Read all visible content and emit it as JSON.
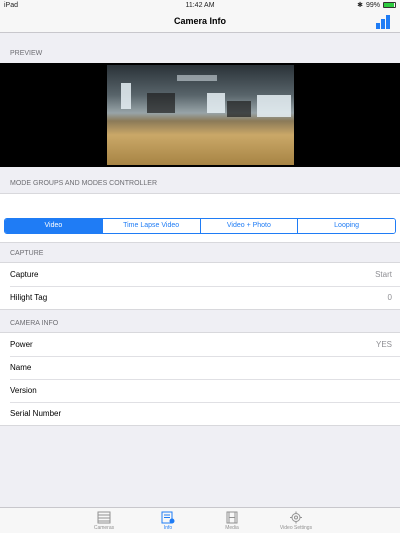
{
  "status_bar": {
    "device": "iPad",
    "time": "11:42 AM",
    "battery": "99%"
  },
  "nav": {
    "title": "Camera Info",
    "chart_button": "bar-chart-icon"
  },
  "preview": {
    "header": "PREVIEW"
  },
  "modes": {
    "header": "MODE GROUPS AND MODES CONTROLLER",
    "segments": [
      "Video",
      "Time Lapse Video",
      "Video + Photo",
      "Looping"
    ],
    "selected": "Video"
  },
  "capture": {
    "header": "CAPTURE",
    "rows": [
      {
        "label": "Capture",
        "value": "Start"
      },
      {
        "label": "Hilight Tag",
        "value": "0"
      }
    ]
  },
  "camera_info": {
    "header": "CAMERA INFO",
    "rows": [
      {
        "label": "Power",
        "value": "YES"
      },
      {
        "label": "Name",
        "value": ""
      },
      {
        "label": "Version",
        "value": ""
      },
      {
        "label": "Serial Number",
        "value": ""
      }
    ]
  },
  "tabs": [
    {
      "label": "Cameras",
      "icon": "list-icon",
      "active": false
    },
    {
      "label": "Info",
      "icon": "info-icon",
      "active": true
    },
    {
      "label": "Media",
      "icon": "film-icon",
      "active": false
    },
    {
      "label": "Video Settings",
      "icon": "gear-icon",
      "active": false
    }
  ],
  "colors": {
    "accent": "#1f7cf5",
    "background": "#efeff4"
  }
}
